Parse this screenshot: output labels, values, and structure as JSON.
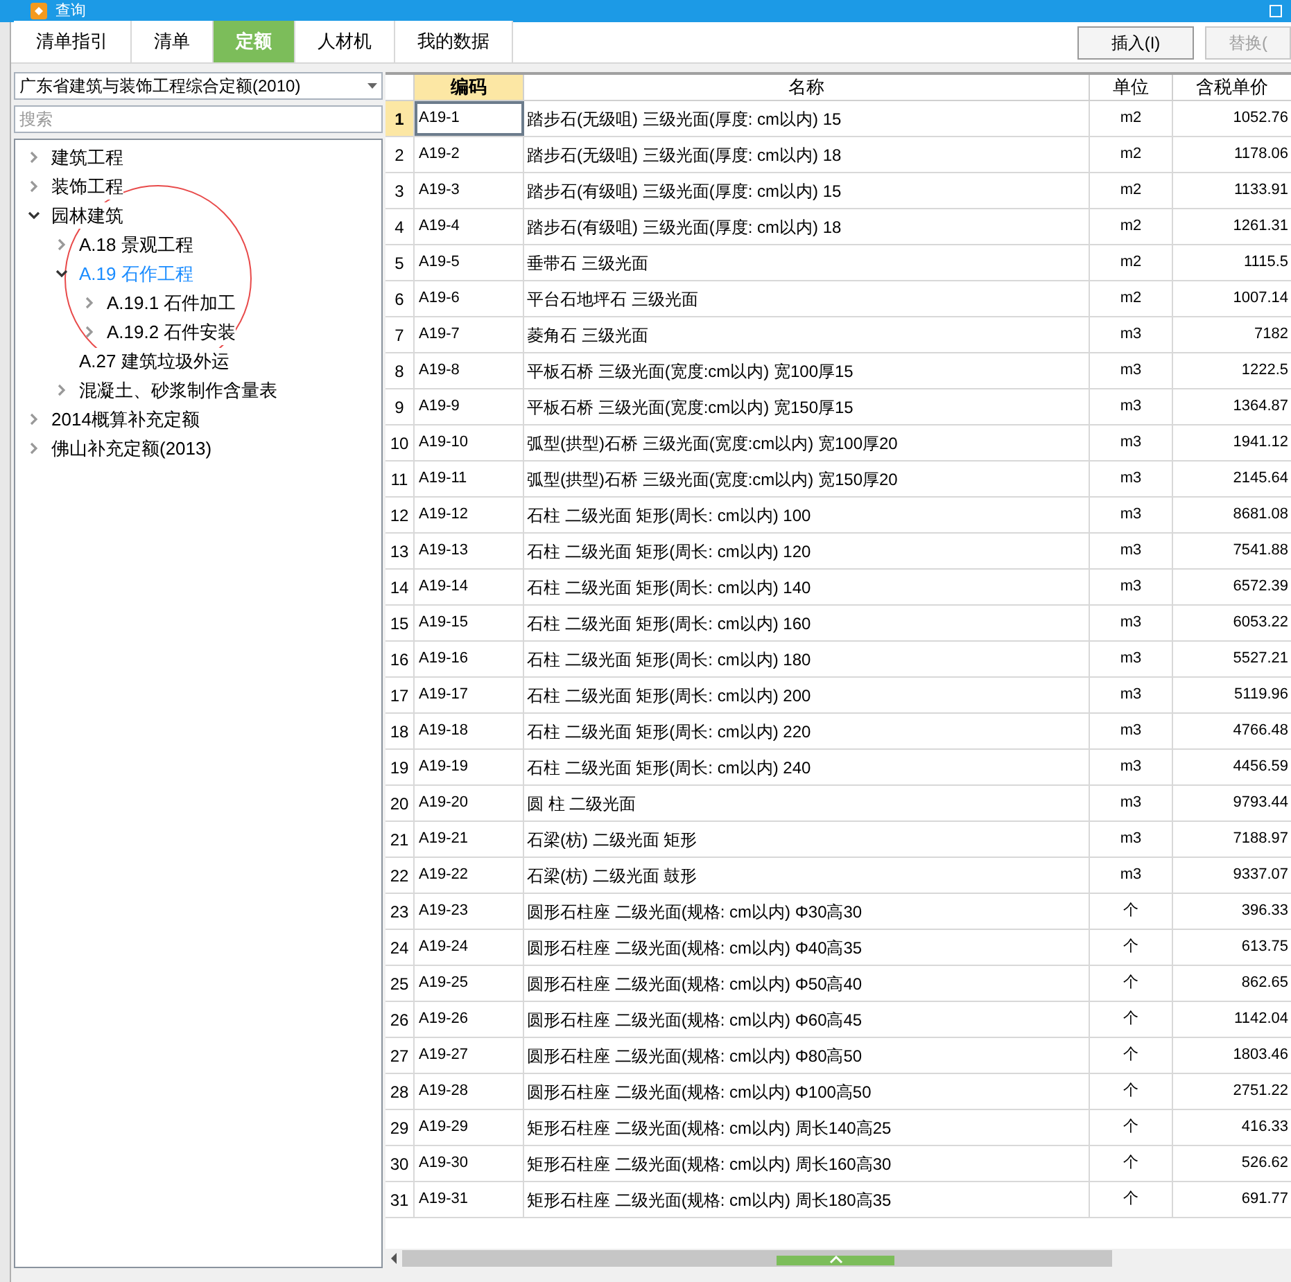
{
  "window": {
    "title": "查询"
  },
  "tabs": [
    {
      "label": "清单指引",
      "selected": false
    },
    {
      "label": "清单",
      "selected": false
    },
    {
      "label": "定额",
      "selected": true
    },
    {
      "label": "人材机",
      "selected": false
    },
    {
      "label": "我的数据",
      "selected": false
    }
  ],
  "buttons": [
    {
      "label": "插入(I)",
      "disabled": false
    },
    {
      "label": "替换(",
      "disabled": true
    }
  ],
  "library_select": {
    "value": "广东省建筑与装饰工程综合定额(2010)"
  },
  "search": {
    "placeholder": "搜索"
  },
  "tree": [
    {
      "label": "建筑工程",
      "expanded": false,
      "selected": false
    },
    {
      "label": "装饰工程",
      "expanded": false,
      "selected": false
    },
    {
      "label": "园林建筑",
      "expanded": true,
      "selected": false,
      "children": [
        {
          "label": "A.18 景观工程",
          "expanded": false,
          "selected": false
        },
        {
          "label": "A.19 石作工程",
          "expanded": true,
          "selected": true,
          "children": [
            {
              "label": "A.19.1 石件加工",
              "expanded": false,
              "selected": false
            },
            {
              "label": "A.19.2 石件安装",
              "expanded": false,
              "selected": false
            }
          ]
        },
        {
          "label": "A.27 建筑垃圾外运",
          "leaf": true,
          "selected": false
        },
        {
          "label": "混凝土、砂浆制作含量表",
          "expanded": false,
          "selected": false
        }
      ]
    },
    {
      "label": "2014概算补充定额",
      "expanded": false,
      "selected": false
    },
    {
      "label": "佛山补充定额(2013)",
      "expanded": false,
      "selected": false
    }
  ],
  "table": {
    "columns": [
      "编码",
      "名称",
      "单位",
      "含税单价"
    ],
    "rows": [
      {
        "no": "1",
        "code": "A19-1",
        "name": "踏步石(无级咀) 三级光面(厚度: cm以内) 15",
        "unit": "m2",
        "price": "1052.76",
        "selected": true
      },
      {
        "no": "2",
        "code": "A19-2",
        "name": "踏步石(无级咀) 三级光面(厚度: cm以内) 18",
        "unit": "m2",
        "price": "1178.06",
        "selected": false
      },
      {
        "no": "3",
        "code": "A19-3",
        "name": "踏步石(有级咀) 三级光面(厚度: cm以内) 15",
        "unit": "m2",
        "price": "1133.91",
        "selected": false
      },
      {
        "no": "4",
        "code": "A19-4",
        "name": "踏步石(有级咀) 三级光面(厚度: cm以内) 18",
        "unit": "m2",
        "price": "1261.31",
        "selected": false
      },
      {
        "no": "5",
        "code": "A19-5",
        "name": "垂带石 三级光面",
        "unit": "m2",
        "price": "1115.5",
        "selected": false
      },
      {
        "no": "6",
        "code": "A19-6",
        "name": "平台石地坪石 三级光面",
        "unit": "m2",
        "price": "1007.14",
        "selected": false
      },
      {
        "no": "7",
        "code": "A19-7",
        "name": "菱角石 三级光面",
        "unit": "m3",
        "price": "7182",
        "selected": false
      },
      {
        "no": "8",
        "code": "A19-8",
        "name": "平板石桥 三级光面(宽度:cm以内) 宽100厚15",
        "unit": "m3",
        "price": "1222.5",
        "selected": false
      },
      {
        "no": "9",
        "code": "A19-9",
        "name": "平板石桥 三级光面(宽度:cm以内) 宽150厚15",
        "unit": "m3",
        "price": "1364.87",
        "selected": false
      },
      {
        "no": "10",
        "code": "A19-10",
        "name": "弧型(拱型)石桥 三级光面(宽度:cm以内) 宽100厚20",
        "unit": "m3",
        "price": "1941.12",
        "selected": false
      },
      {
        "no": "11",
        "code": "A19-11",
        "name": "弧型(拱型)石桥 三级光面(宽度:cm以内) 宽150厚20",
        "unit": "m3",
        "price": "2145.64",
        "selected": false
      },
      {
        "no": "12",
        "code": "A19-12",
        "name": "石柱 二级光面 矩形(周长: cm以内) 100",
        "unit": "m3",
        "price": "8681.08",
        "selected": false
      },
      {
        "no": "13",
        "code": "A19-13",
        "name": "石柱 二级光面 矩形(周长: cm以内) 120",
        "unit": "m3",
        "price": "7541.88",
        "selected": false
      },
      {
        "no": "14",
        "code": "A19-14",
        "name": "石柱 二级光面 矩形(周长: cm以内) 140",
        "unit": "m3",
        "price": "6572.39",
        "selected": false
      },
      {
        "no": "15",
        "code": "A19-15",
        "name": "石柱 二级光面 矩形(周长: cm以内) 160",
        "unit": "m3",
        "price": "6053.22",
        "selected": false
      },
      {
        "no": "16",
        "code": "A19-16",
        "name": "石柱 二级光面 矩形(周长: cm以内) 180",
        "unit": "m3",
        "price": "5527.21",
        "selected": false
      },
      {
        "no": "17",
        "code": "A19-17",
        "name": "石柱 二级光面 矩形(周长: cm以内) 200",
        "unit": "m3",
        "price": "5119.96",
        "selected": false
      },
      {
        "no": "18",
        "code": "A19-18",
        "name": "石柱 二级光面 矩形(周长: cm以内) 220",
        "unit": "m3",
        "price": "4766.48",
        "selected": false
      },
      {
        "no": "19",
        "code": "A19-19",
        "name": "石柱 二级光面 矩形(周长: cm以内) 240",
        "unit": "m3",
        "price": "4456.59",
        "selected": false
      },
      {
        "no": "20",
        "code": "A19-20",
        "name": "圆 柱 二级光面",
        "unit": "m3",
        "price": "9793.44",
        "selected": false
      },
      {
        "no": "21",
        "code": "A19-21",
        "name": "石梁(枋) 二级光面 矩形",
        "unit": "m3",
        "price": "7188.97",
        "selected": false
      },
      {
        "no": "22",
        "code": "A19-22",
        "name": "石梁(枋) 二级光面 鼓形",
        "unit": "m3",
        "price": "9337.07",
        "selected": false
      },
      {
        "no": "23",
        "code": "A19-23",
        "name": "圆形石柱座 二级光面(规格: cm以内) Φ30高30",
        "unit": "个",
        "price": "396.33",
        "selected": false
      },
      {
        "no": "24",
        "code": "A19-24",
        "name": "圆形石柱座 二级光面(规格: cm以内) Φ40高35",
        "unit": "个",
        "price": "613.75",
        "selected": false
      },
      {
        "no": "25",
        "code": "A19-25",
        "name": "圆形石柱座 二级光面(规格: cm以内) Φ50高40",
        "unit": "个",
        "price": "862.65",
        "selected": false
      },
      {
        "no": "26",
        "code": "A19-26",
        "name": "圆形石柱座 二级光面(规格: cm以内) Φ60高45",
        "unit": "个",
        "price": "1142.04",
        "selected": false
      },
      {
        "no": "27",
        "code": "A19-27",
        "name": "圆形石柱座 二级光面(规格: cm以内) Φ80高50",
        "unit": "个",
        "price": "1803.46",
        "selected": false
      },
      {
        "no": "28",
        "code": "A19-28",
        "name": "圆形石柱座 二级光面(规格: cm以内) Φ100高50",
        "unit": "个",
        "price": "2751.22",
        "selected": false
      },
      {
        "no": "29",
        "code": "A19-29",
        "name": "矩形石柱座 二级光面(规格: cm以内) 周长140高25",
        "unit": "个",
        "price": "416.33",
        "selected": false
      },
      {
        "no": "30",
        "code": "A19-30",
        "name": "矩形石柱座 二级光面(规格: cm以内) 周长160高30",
        "unit": "个",
        "price": "526.62",
        "selected": false
      },
      {
        "no": "31",
        "code": "A19-31",
        "name": "矩形石柱座 二级光面(规格: cm以内) 周长180高35",
        "unit": "个",
        "price": "691.77",
        "selected": false
      }
    ]
  }
}
